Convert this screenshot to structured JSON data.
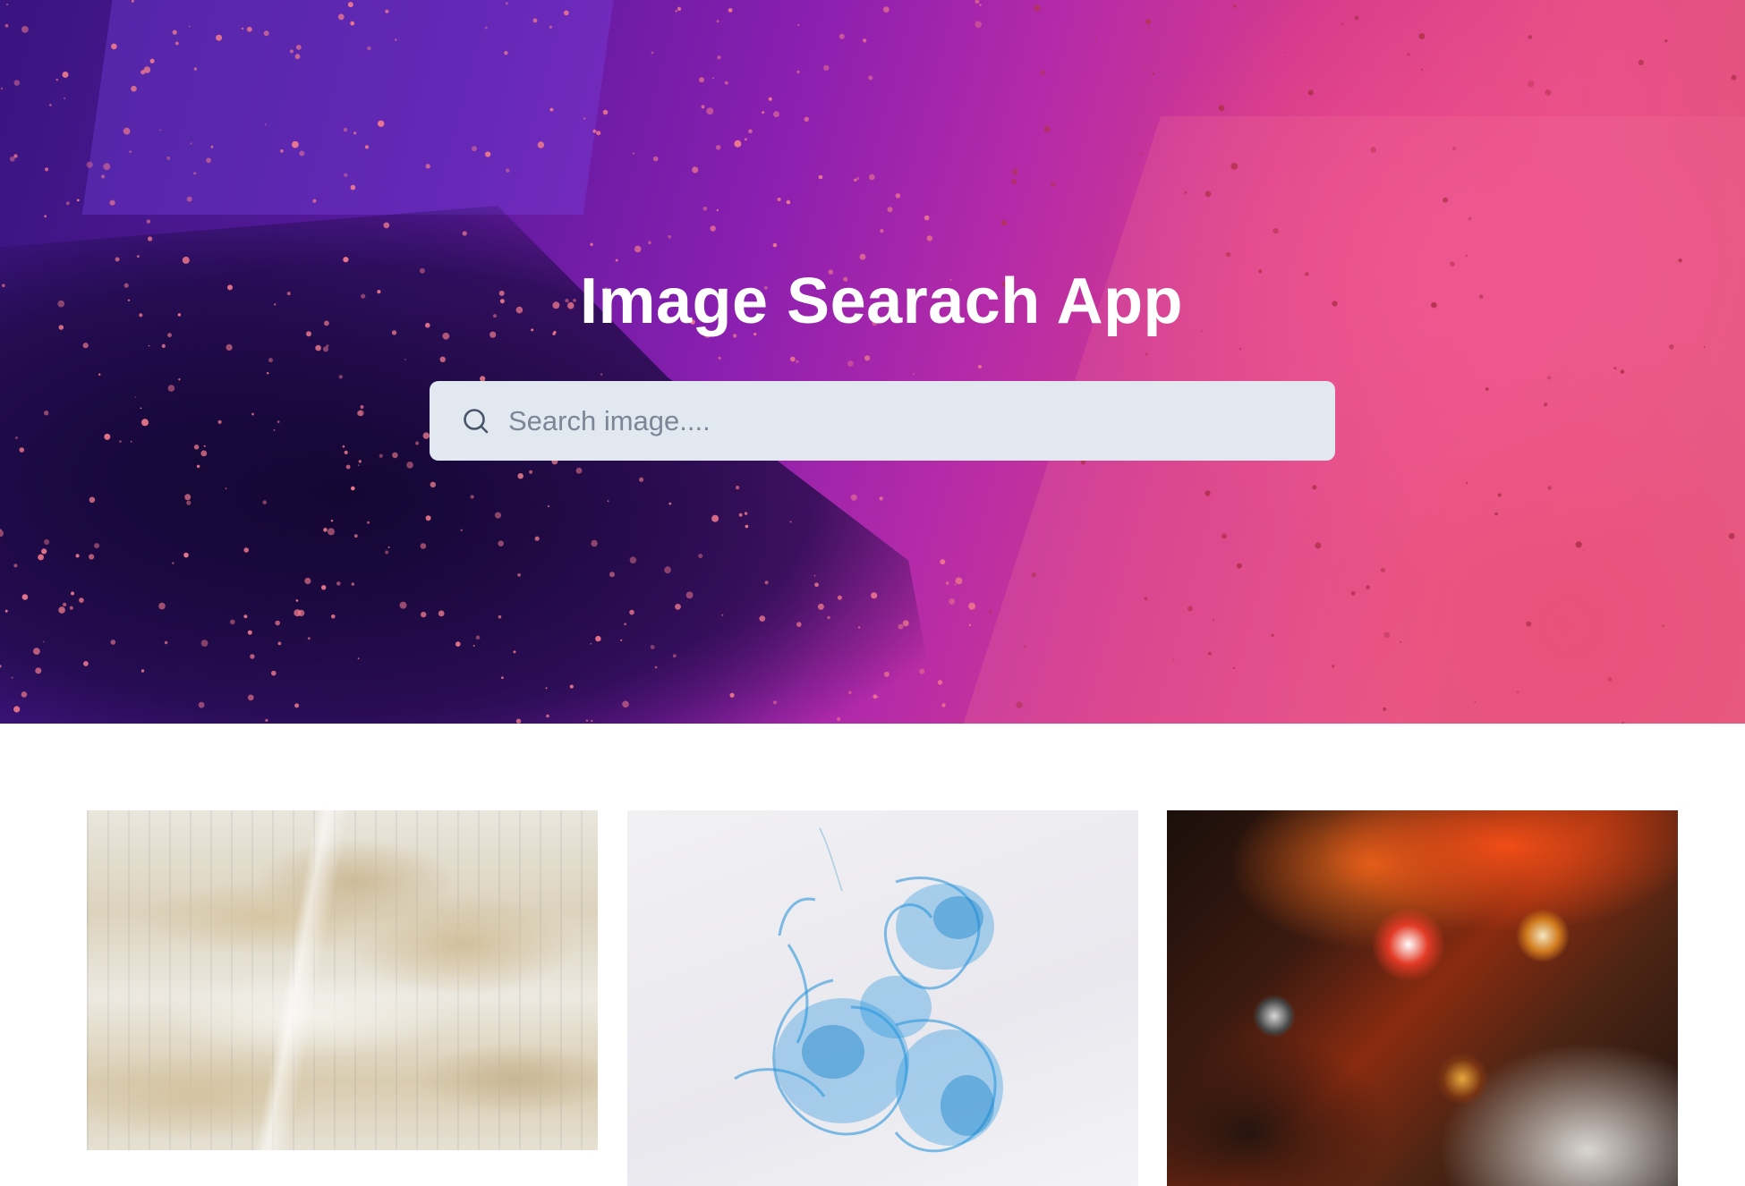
{
  "hero": {
    "title": "Image Searach App",
    "search": {
      "placeholder": "Search image....",
      "value": "",
      "icon": "search-icon"
    }
  },
  "gallery": {
    "images": [
      {
        "alt": "Textured paint strokes"
      },
      {
        "alt": "Blue ink in water"
      },
      {
        "alt": "Fluid acrylic art"
      }
    ]
  },
  "colors": {
    "search_bg": "#e2e8f0",
    "title_color": "#ffffff",
    "hero_left": "#3a1480",
    "hero_right": "#e2557b"
  }
}
